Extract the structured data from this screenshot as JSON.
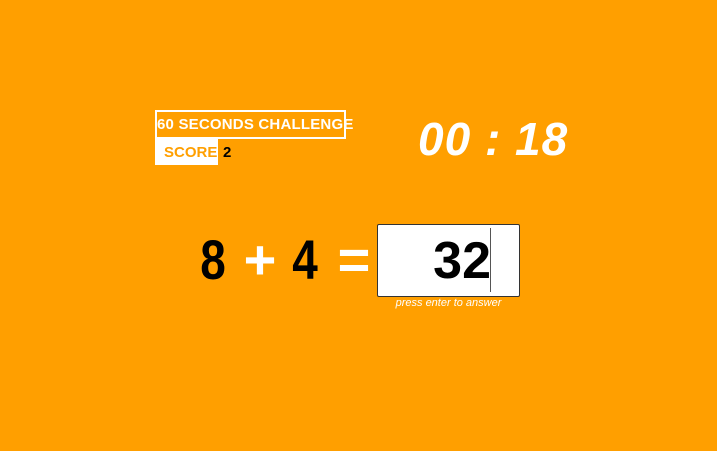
{
  "game": {
    "title": "60 SECONDS CHALLENGE",
    "score_label": "SCORE",
    "score_value": "2",
    "timer": "00 : 18"
  },
  "equation": {
    "operand_a": "8",
    "operator": "+",
    "operand_b": "4",
    "equals": "=",
    "answer_value": "32",
    "hint": "press enter to answer"
  },
  "colors": {
    "background": "#FF9F00",
    "text_light": "#FFFFFF",
    "text_dark": "#000000"
  }
}
